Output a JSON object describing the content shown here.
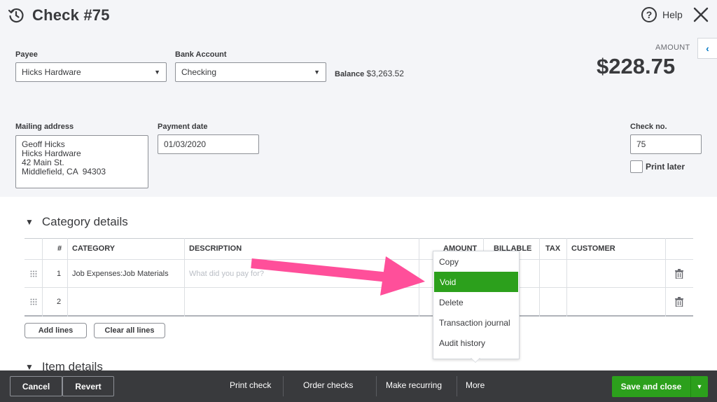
{
  "header": {
    "title": "Check #75",
    "help_label": "Help",
    "amount_label": "AMOUNT",
    "amount_value": "$228.75"
  },
  "payee": {
    "label": "Payee",
    "value": "Hicks Hardware"
  },
  "bank_account": {
    "label": "Bank Account",
    "value": "Checking"
  },
  "balance": {
    "label": "Balance",
    "value": "$3,263.52"
  },
  "mailing_address": {
    "label": "Mailing address",
    "lines": [
      "Geoff Hicks",
      "Hicks Hardware",
      "42 Main St.",
      "Middlefield, CA  94303"
    ]
  },
  "payment_date": {
    "label": "Payment date",
    "value": "01/03/2020"
  },
  "check_no": {
    "label": "Check no.",
    "value": "75"
  },
  "print_later": {
    "label": "Print later",
    "checked": false
  },
  "category_details": {
    "title": "Category details",
    "columns": [
      "#",
      "CATEGORY",
      "DESCRIPTION",
      "AMOUNT",
      "BILLABLE",
      "TAX",
      "CUSTOMER"
    ],
    "rows": [
      {
        "num": "1",
        "category": "Job Expenses:Job Materials",
        "description_placeholder": "What did you pay for?"
      },
      {
        "num": "2",
        "category": "",
        "description_placeholder": ""
      }
    ],
    "add_lines_label": "Add lines",
    "clear_lines_label": "Clear all lines"
  },
  "item_details": {
    "title": "Item details"
  },
  "more_menu": {
    "items": [
      "Copy",
      "Void",
      "Delete",
      "Transaction journal",
      "Audit history"
    ],
    "highlighted": "Void"
  },
  "footer": {
    "cancel_label": "Cancel",
    "revert_label": "Revert",
    "print_check_label": "Print check",
    "order_checks_label": "Order checks",
    "make_recurring_label": "Make recurring",
    "more_label": "More",
    "save_close_label": "Save and close"
  },
  "colors": {
    "accent_green": "#2ca01c",
    "footer_bg": "#393a3d",
    "arrow_pink": "#ff4f9a",
    "header_bg": "#f4f5f8"
  }
}
